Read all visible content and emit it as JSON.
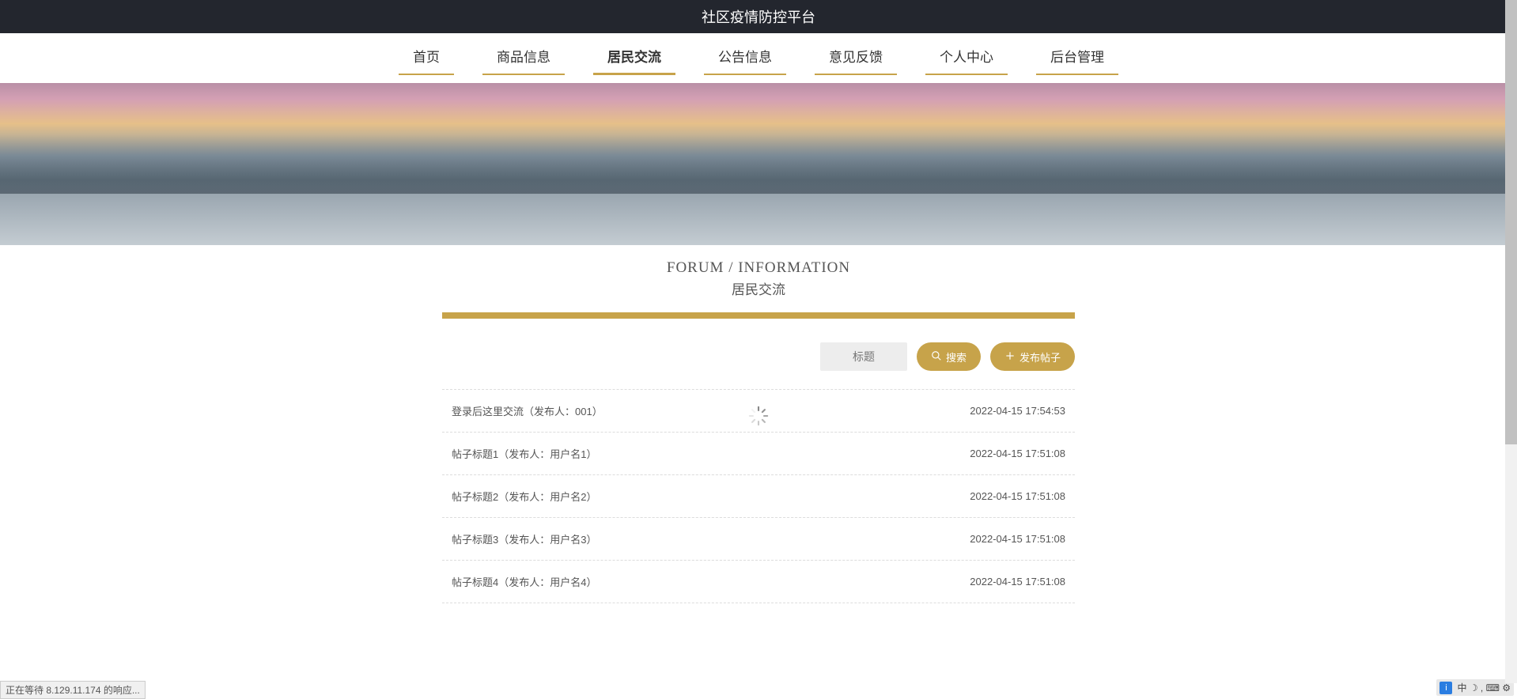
{
  "header": {
    "title": "社区疫情防控平台"
  },
  "nav": {
    "items": [
      {
        "label": "首页",
        "active": false
      },
      {
        "label": "商品信息",
        "active": false
      },
      {
        "label": "居民交流",
        "active": true
      },
      {
        "label": "公告信息",
        "active": false
      },
      {
        "label": "意见反馈",
        "active": false
      },
      {
        "label": "个人中心",
        "active": false
      },
      {
        "label": "后台管理",
        "active": false
      }
    ]
  },
  "section": {
    "title_en": "FORUM / INFORMATION",
    "title_cn": "居民交流"
  },
  "toolbar": {
    "search_placeholder": "标题",
    "search_value": "",
    "search_button": "搜索",
    "post_button": "发布帖子"
  },
  "posts": [
    {
      "title": "登录后这里交流（发布人：001）",
      "time": "2022-04-15 17:54:53"
    },
    {
      "title": "帖子标题1（发布人：用户名1）",
      "time": "2022-04-15 17:51:08"
    },
    {
      "title": "帖子标题2（发布人：用户名2）",
      "time": "2022-04-15 17:51:08"
    },
    {
      "title": "帖子标题3（发布人：用户名3）",
      "time": "2022-04-15 17:51:08"
    },
    {
      "title": "帖子标题4（发布人：用户名4）",
      "time": "2022-04-15 17:51:08"
    }
  ],
  "status": {
    "text": "正在等待 8.129.11.174 的响应..."
  },
  "ime": {
    "badge": "i",
    "items": [
      "中",
      "☽",
      ",",
      "⌨",
      "⚙"
    ]
  }
}
